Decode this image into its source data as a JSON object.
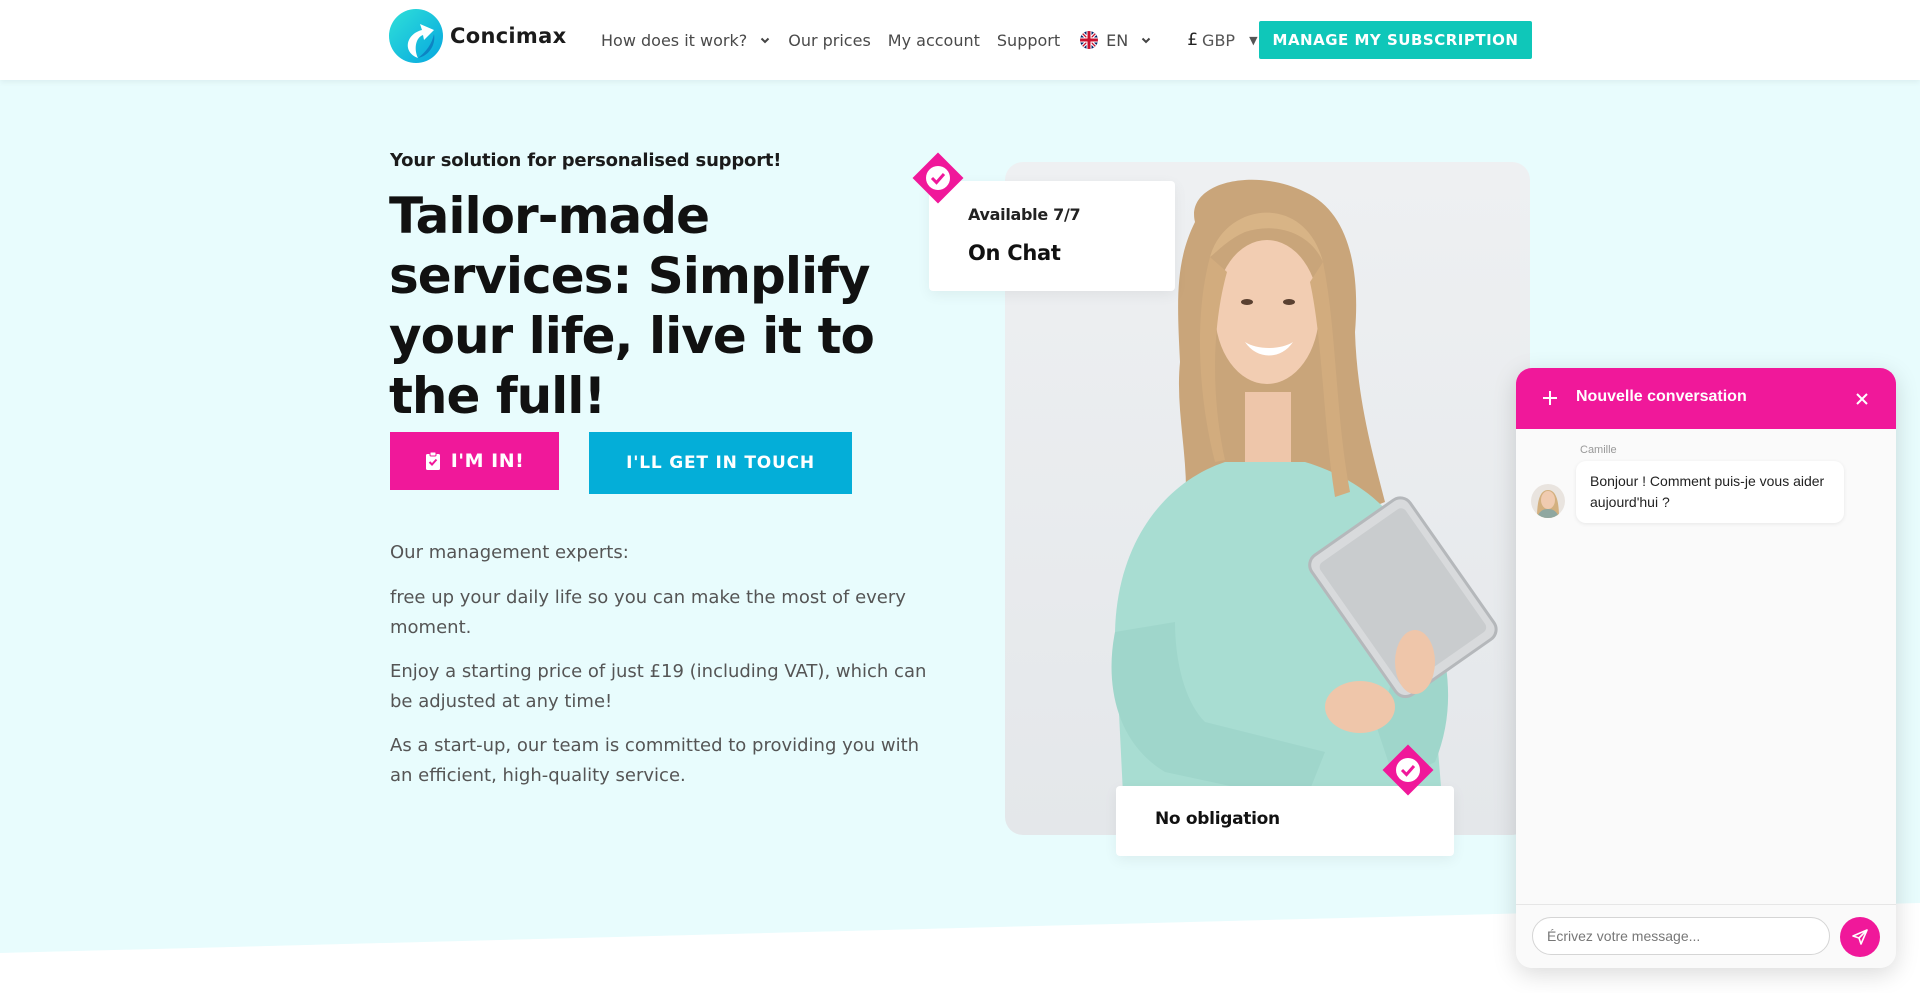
{
  "header": {
    "brand": "Concimax",
    "nav": {
      "how_it_works": "How does it work?",
      "prices": "Our prices",
      "account": "My account",
      "support": "Support",
      "language": "EN",
      "currency_symbol": "£",
      "currency": "GBP"
    },
    "manage_button": "MANAGE MY SUBSCRIPTION"
  },
  "hero": {
    "tagline": "Your solution for personalised support!",
    "headline": "Tailor-made services: Simplify your life, live it to the full!",
    "cta_primary": "I'M IN!",
    "cta_secondary": "I'LL GET IN TOUCH",
    "paragraphs": [
      "Our management experts:",
      "free up your daily life so you can make the most of every moment.",
      "Enjoy a starting price of just £19 (including VAT), which can be adjusted at any time!",
      "As a start-up, our team is committed to providing you with an efficient, high-quality service."
    ],
    "badge_available": {
      "line1": "Available 7/7",
      "line2": "On Chat"
    },
    "badge_obligation": "No obligation"
  },
  "chat": {
    "title": "Nouvelle conversation",
    "agent_name": "Camille",
    "message": "Bonjour ! Comment puis-je vous aider aujourd'hui ?",
    "input_placeholder": "Écrivez votre message..."
  },
  "colors": {
    "brand_pink": "#f0189a",
    "brand_teal": "#0fc7b9",
    "brand_blue": "#04aed8",
    "hero_bg": "#e8fcfd"
  }
}
